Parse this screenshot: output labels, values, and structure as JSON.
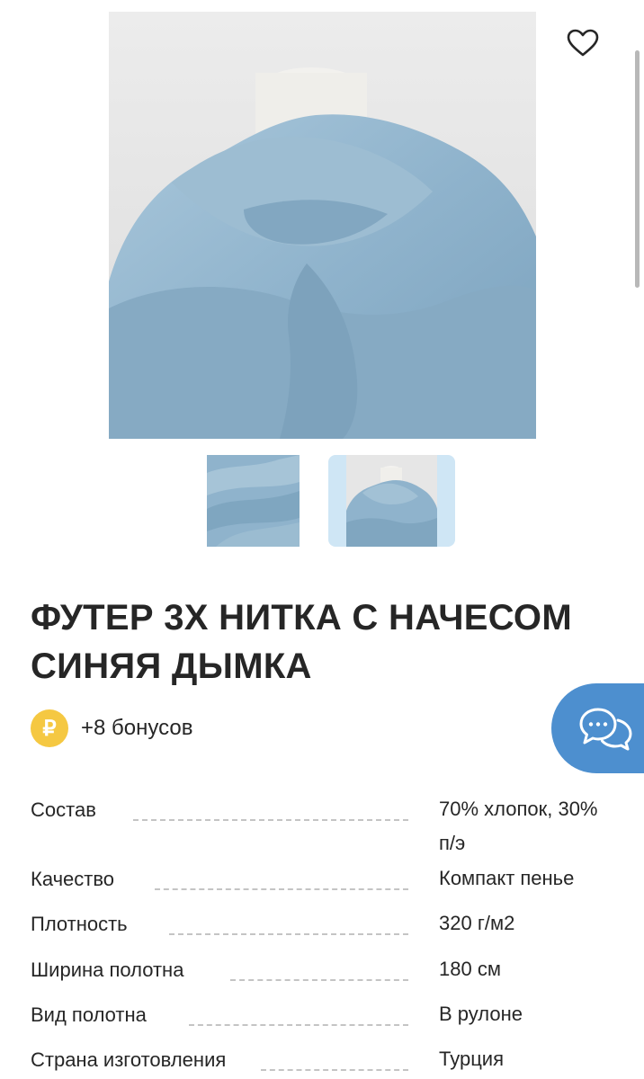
{
  "product": {
    "title": "ФУТЕР 3Х НИТКА С НАЧЕСОМ СИНЯЯ ДЫМКА",
    "main_image_icon": "draped-fabric-on-mannequin",
    "thumbnail_count": 2,
    "selected_thumbnail": 2,
    "favorite_icon": "heart-outline-icon"
  },
  "bonus": {
    "currency_symbol": "₽",
    "text": "+8 бонусов"
  },
  "specs": [
    {
      "key": "Состав",
      "value": "70% хлопок, 30% п/э"
    },
    {
      "key": "Качество",
      "value": "Компакт пенье"
    },
    {
      "key": "Плотность",
      "value": "320 г/м2"
    },
    {
      "key": "Ширина полотна",
      "value": "180 см"
    },
    {
      "key": "Вид полотна",
      "value": "В рулоне"
    },
    {
      "key": "Страна изготовления",
      "value": "Турция"
    }
  ],
  "chat": {
    "icon": "chat-bubbles-icon"
  },
  "colors": {
    "fabric": "#8fb3cc",
    "accent": "#4d8fcf",
    "coin": "#f5c842"
  }
}
